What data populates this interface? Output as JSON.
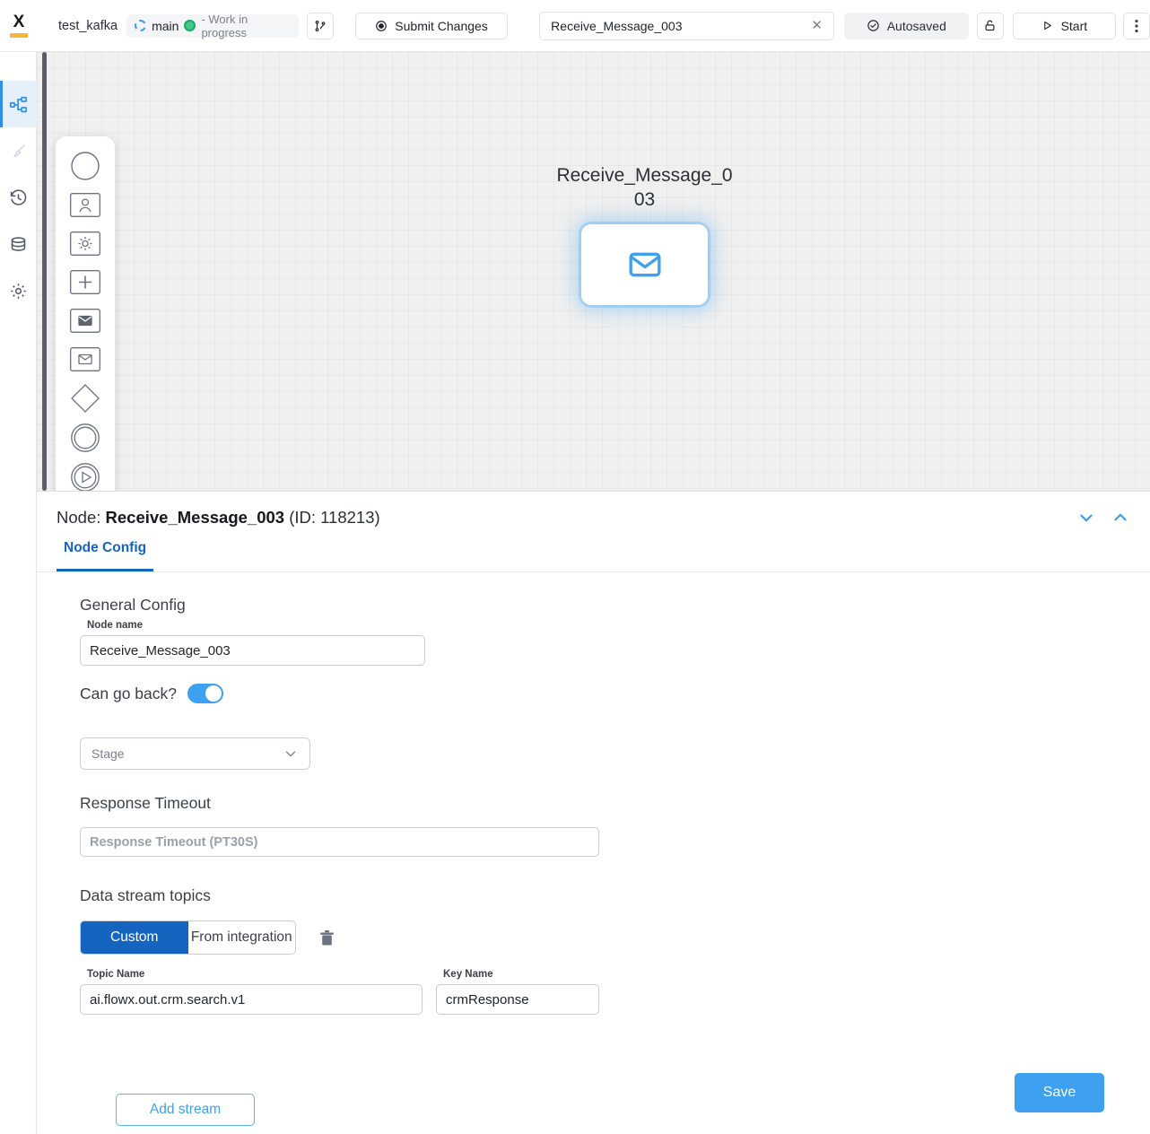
{
  "topbar": {
    "logo_letter": "X",
    "project_name": "test_kafka",
    "branch_name": "main",
    "branch_status": "- Work in progress",
    "branch_icon": "git-branch-icon",
    "submit_label": "Submit Changes",
    "submit_icon": "record-circle-icon",
    "search_value": "Receive_Message_003",
    "search_clear_icon": "close-icon",
    "autosaved_label": "Autosaved",
    "autosaved_icon": "check-circle-icon",
    "lock_icon": "unlock-icon",
    "start_label": "Start",
    "start_icon": "play-icon",
    "kebab_icon": "more-vertical-icon"
  },
  "rail": {
    "items": [
      {
        "name": "process-editor",
        "icon": "flow-nodes-icon",
        "active": true
      },
      {
        "name": "theme-editor",
        "icon": "brush-icon",
        "active": false
      },
      {
        "name": "history",
        "icon": "history-clock-icon",
        "active": false
      },
      {
        "name": "data-model",
        "icon": "database-icon",
        "active": false
      },
      {
        "name": "settings",
        "icon": "gear-icon",
        "active": false
      }
    ]
  },
  "palette": {
    "items": [
      {
        "name": "start-node",
        "icon": "circle-icon"
      },
      {
        "name": "user-task-node",
        "icon": "user-task-icon"
      },
      {
        "name": "service-task-node",
        "icon": "gear-task-icon"
      },
      {
        "name": "plus-node",
        "icon": "plus-task-icon"
      },
      {
        "name": "send-message-node",
        "icon": "send-envelope-icon"
      },
      {
        "name": "receive-message-node",
        "icon": "receive-envelope-icon"
      },
      {
        "name": "exclusive-gateway-node",
        "icon": "diamond-icon"
      },
      {
        "name": "end-node",
        "icon": "double-circle-icon"
      },
      {
        "name": "start-event-node",
        "icon": "play-circle-icon"
      }
    ]
  },
  "canvas": {
    "node_label": "Receive_Message_003",
    "node_icon": "envelope-icon"
  },
  "panel": {
    "title_prefix": "Node: ",
    "node_name": "Receive_Message_003",
    "title_suffix": " (ID: 118213)",
    "collapse_icon": "chevron-down-icon",
    "expand_icon": "chevron-up-icon",
    "tab_label": "Node Config",
    "general_config_heading": "General Config",
    "node_name_label": "Node name",
    "node_name_value": "Receive_Message_003",
    "can_go_back_label": "Can go back?",
    "can_go_back_on": true,
    "stage_placeholder": "Stage",
    "stage_chevron_icon": "chevron-down-icon",
    "response_timeout_heading": "Response Timeout",
    "response_timeout_placeholder": "Response Timeout (PT30S)",
    "data_stream_heading": "Data stream topics",
    "seg_custom": "Custom",
    "seg_from_integration": "From integration",
    "delete_icon": "trash-icon",
    "topic_name_label": "Topic Name",
    "topic_name_value": "ai.flowx.out.crm.search.v1",
    "key_name_label": "Key Name",
    "key_name_value": "crmResponse",
    "add_stream_label": "Add stream",
    "save_label": "Save"
  },
  "colors": {
    "accent_blue": "#3ea0f0",
    "tab_blue": "#1565c0",
    "logo_orange": "#f7b733",
    "status_green": "#44c98a"
  }
}
